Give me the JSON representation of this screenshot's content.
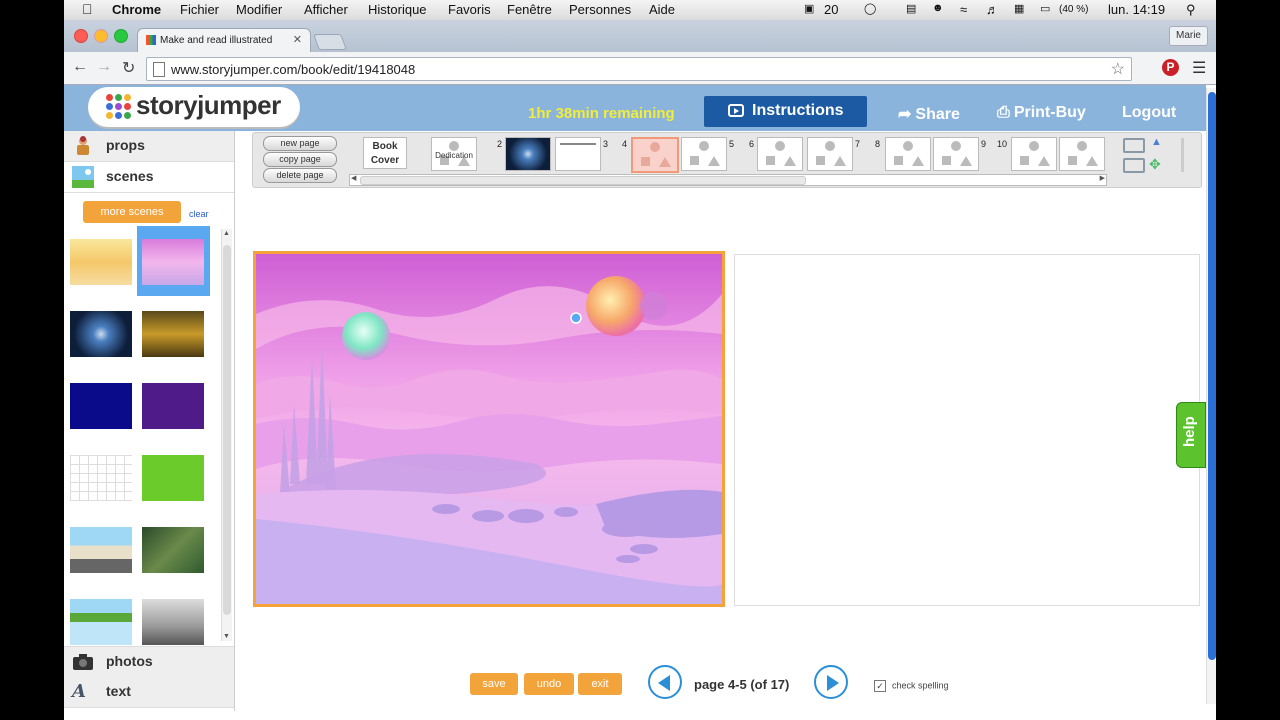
{
  "menubar": {
    "app": "Chrome",
    "items": [
      "Fichier",
      "Modifier",
      "Afficher",
      "Historique",
      "Favoris",
      "Fenêtre",
      "Personnes",
      "Aide"
    ],
    "status_count": "20",
    "battery": "(40 %)",
    "clock": "lun. 14:19"
  },
  "browser": {
    "tab_title": "Make and read illustrated",
    "profile": "Marie",
    "url": "www.storyjumper.com/book/edit/19418048"
  },
  "header": {
    "logo": "storyjumper",
    "remaining": "1hr 38min remaining",
    "instructions": "Instructions",
    "share": "Share",
    "print_buy": "Print-Buy",
    "logout": "Logout"
  },
  "left_panel": {
    "props": "props",
    "scenes": "scenes",
    "more_scenes": "more scenes",
    "clear": "clear",
    "photos": "photos",
    "text": "text"
  },
  "page_strip": {
    "new_page": "new page",
    "copy_page": "copy page",
    "delete_page": "delete page",
    "book_cover": "Book Cover",
    "dedication": "Dedication",
    "numbers": [
      "2",
      "3",
      "4",
      "5",
      "6",
      "7",
      "8",
      "9",
      "10"
    ]
  },
  "help": "help",
  "bottom": {
    "save": "save",
    "undo": "undo",
    "exit": "exit",
    "page_info": "page 4-5 (of 17)",
    "check_spelling": "check spelling"
  },
  "colors": {
    "header_blue": "#8bb4dd",
    "accent_orange": "#f2a33a",
    "instructions_blue": "#1d5aa4",
    "help_green": "#5cc22e",
    "remaining_yellow": "#f2ec3a"
  }
}
